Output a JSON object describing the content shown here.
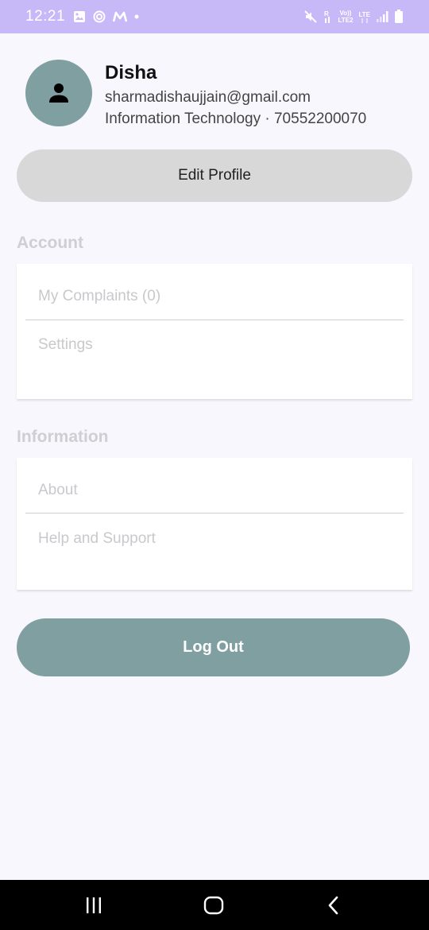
{
  "status_bar": {
    "time": "12:21",
    "network_label_top": "Vo))",
    "network_label_bottom": "LTE2",
    "network_type": "LTE",
    "icons": [
      "gallery-icon",
      "swirl-app-icon",
      "m-app-icon",
      "dot-icon",
      "mute-icon",
      "signal-r-icon",
      "volte-icon",
      "signal-icon",
      "battery-icon"
    ]
  },
  "profile": {
    "name": "Disha",
    "email": "sharmadishaujjain@gmail.com",
    "meta": "Information Technology · 70552200070",
    "avatar_icon": "person-icon"
  },
  "edit_profile_label": "Edit Profile",
  "account": {
    "title": "Account",
    "items": [
      {
        "label": "My Complaints (0)"
      },
      {
        "label": "Settings"
      }
    ]
  },
  "information": {
    "title": "Information",
    "items": [
      {
        "label": "About"
      },
      {
        "label": "Help and Support"
      }
    ]
  },
  "logout_label": "Log Out",
  "colors": {
    "status_bar": "#c7b8f7",
    "accent": "#809fa1",
    "page_bg": "#f8f7fd",
    "edit_button": "#d8d8d9"
  },
  "nav_bar": {
    "icons": [
      "recent-apps-icon",
      "home-icon",
      "back-icon"
    ]
  }
}
